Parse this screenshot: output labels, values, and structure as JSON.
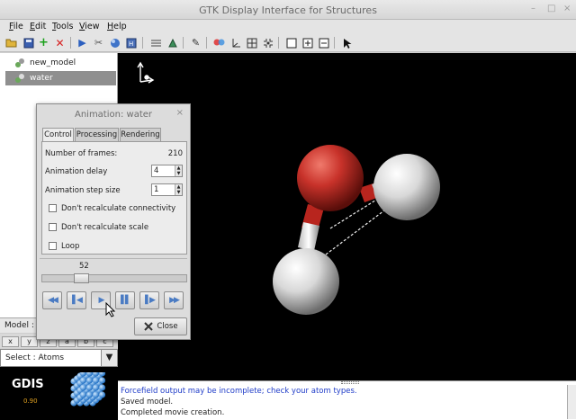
{
  "window": {
    "title": "GTK Display Interface for Structures",
    "minimize": "–",
    "maximize": "□",
    "close": "×"
  },
  "menu": [
    {
      "label": "File",
      "name": "menu-file"
    },
    {
      "label": "Edit",
      "name": "menu-edit"
    },
    {
      "label": "Tools",
      "name": "menu-tools"
    },
    {
      "label": "View",
      "name": "menu-view"
    },
    {
      "label": "Help",
      "name": "menu-help"
    }
  ],
  "toolbar_icons": [
    "open-folder-icon",
    "save-icon",
    "new-icon",
    "delete-icon",
    "play-icon",
    "tools-icon",
    "render-icon",
    "frame-icon",
    "measure-icon",
    "atom-icon",
    "pen-icon",
    "color-icon",
    "axes-icon",
    "grid-icon",
    "fit-icon",
    "box-icon",
    "plus-box-icon",
    "minus-box-icon",
    "pointer-icon"
  ],
  "tree": {
    "items": [
      {
        "label": "new_model",
        "selected": false
      },
      {
        "label": "water",
        "selected": true
      }
    ]
  },
  "model_label": "Model :",
  "axis_tabs": [
    "x",
    "y",
    "z",
    "a",
    "b",
    "c"
  ],
  "select_mode": {
    "value": "Atoms"
  },
  "logo": {
    "name": "GDIS",
    "version": "0.90"
  },
  "status": {
    "lines": [
      {
        "text": "Forcefield output may be incomplete; check your atom types.",
        "color": "#1f3cc8"
      },
      {
        "text": "Saved model.",
        "color": "#222222"
      },
      {
        "text": "Completed movie creation.",
        "color": "#222222"
      }
    ]
  },
  "dialog": {
    "title": "Animation: water",
    "close": "×",
    "tabs": [
      {
        "label": "Control",
        "active": true
      },
      {
        "label": "Processing",
        "active": false
      },
      {
        "label": "Rendering",
        "active": false
      }
    ],
    "frames_label": "Number of frames:",
    "frames_value": "210",
    "delay_label": "Animation delay",
    "delay_value": "4",
    "step_label": "Animation step size",
    "step_value": "1",
    "checkboxes": [
      {
        "label": "Don't recalculate connectivity",
        "checked": false
      },
      {
        "label": "Don't recalculate scale",
        "checked": false
      },
      {
        "label": "Loop",
        "checked": false
      }
    ],
    "slider": {
      "value": "52",
      "fraction": 0.248
    },
    "controls": [
      "rewind",
      "step-back",
      "play",
      "pause",
      "step-forward",
      "fast-forward"
    ],
    "close_label": "Close"
  },
  "colors": {
    "oxygen": "#c8322a",
    "hydrogen": "#e6e6e6",
    "status_warning": "#1f3cc8"
  }
}
